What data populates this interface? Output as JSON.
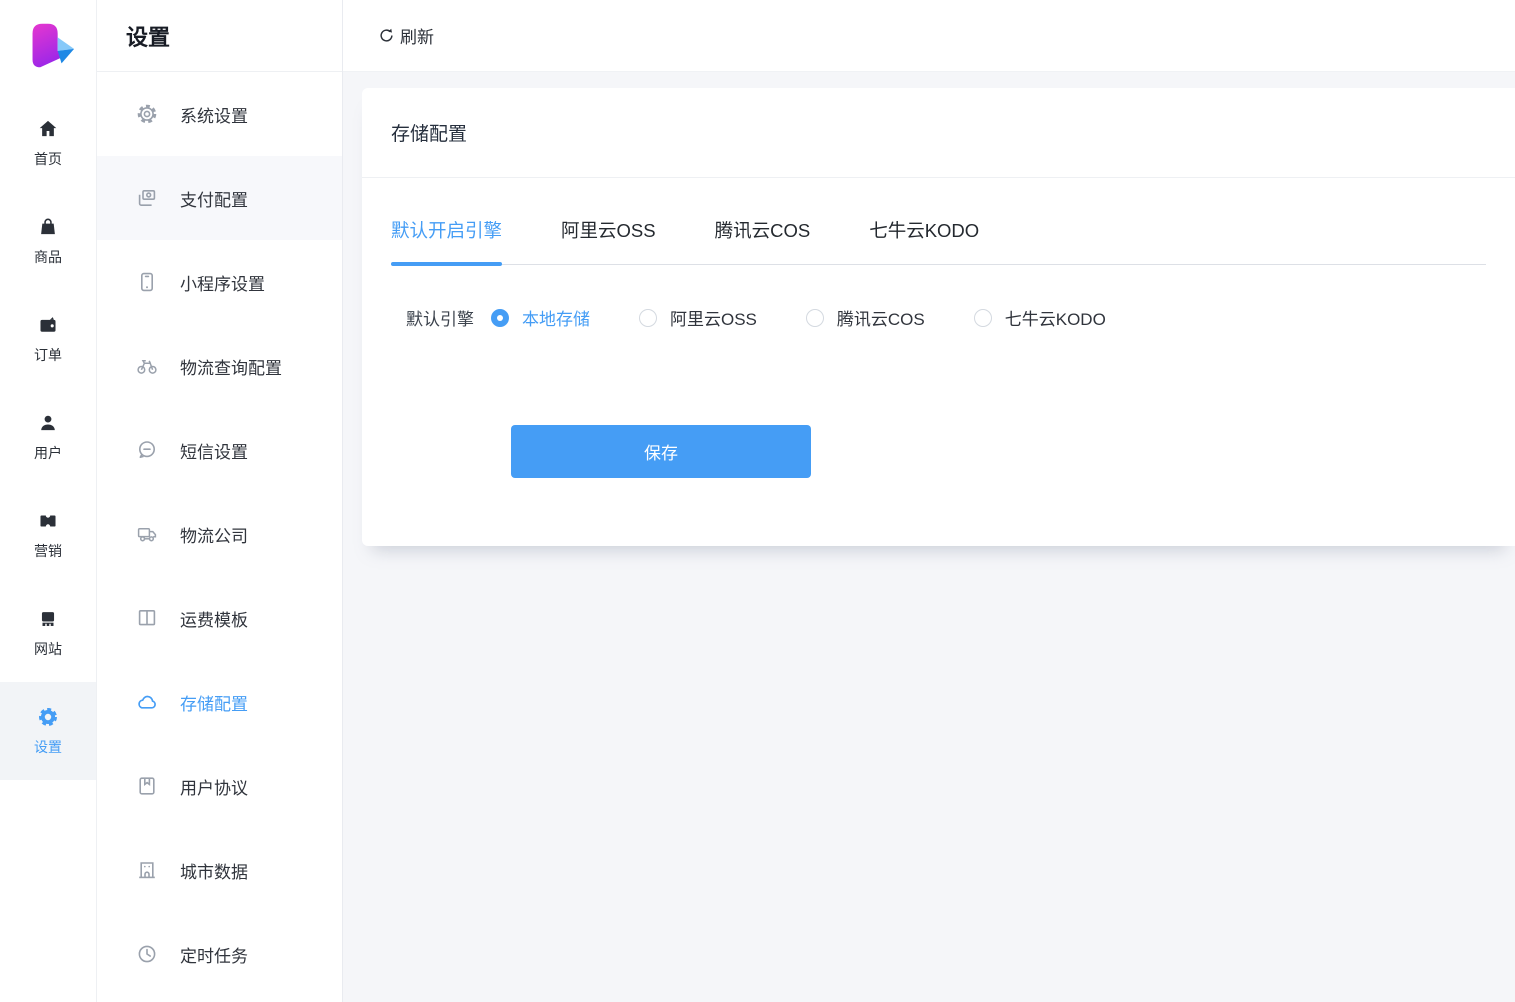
{
  "colors": {
    "accent": "#459df5",
    "content_bg": "#f5f6f9",
    "sidebar_bg": "#ffffff"
  },
  "iconbar": {
    "items": [
      {
        "label": "首页",
        "icon": "home-icon",
        "active": false
      },
      {
        "label": "商品",
        "icon": "goods-bag-icon",
        "active": false
      },
      {
        "label": "订单",
        "icon": "order-wallet-icon",
        "active": false
      },
      {
        "label": "用户",
        "icon": "user-icon",
        "active": false
      },
      {
        "label": "营销",
        "icon": "marketing-ticket-icon",
        "active": false
      },
      {
        "label": "网站",
        "icon": "website-icon",
        "active": false
      },
      {
        "label": "设置",
        "icon": "settings-gear-icon",
        "active": true
      }
    ]
  },
  "submenu": {
    "title": "设置",
    "items": [
      {
        "label": "系统设置",
        "icon": "system-gear-icon",
        "active": false,
        "highlighted": false
      },
      {
        "label": "支付配置",
        "icon": "payment-icon",
        "active": false,
        "highlighted": true
      },
      {
        "label": "小程序设置",
        "icon": "miniprogram-phone-icon",
        "active": false,
        "highlighted": false
      },
      {
        "label": "物流查询配置",
        "icon": "logistics-query-bicycle-icon",
        "active": false,
        "highlighted": false
      },
      {
        "label": "短信设置",
        "icon": "sms-chat-icon",
        "active": false,
        "highlighted": false
      },
      {
        "label": "物流公司",
        "icon": "logistics-truck-icon",
        "active": false,
        "highlighted": false
      },
      {
        "label": "运费模板",
        "icon": "freight-template-book-icon",
        "active": false,
        "highlighted": false
      },
      {
        "label": "存储配置",
        "icon": "storage-cloud-icon",
        "active": true,
        "highlighted": false
      },
      {
        "label": "用户协议",
        "icon": "agreement-book-icon",
        "active": false,
        "highlighted": false
      },
      {
        "label": "城市数据",
        "icon": "city-data-building-icon",
        "active": false,
        "highlighted": false
      },
      {
        "label": "定时任务",
        "icon": "scheduled-task-clock-icon",
        "active": false,
        "highlighted": false
      }
    ]
  },
  "topbar": {
    "refresh_label": "刷新"
  },
  "card": {
    "title": "存储配置",
    "tabs": [
      {
        "label": "默认开启引擎",
        "active": true
      },
      {
        "label": "阿里云OSS",
        "active": false
      },
      {
        "label": "腾讯云COS",
        "active": false
      },
      {
        "label": "七牛云KODO",
        "active": false
      }
    ],
    "form": {
      "engine_label": "默认引擎",
      "options": [
        {
          "label": "本地存储",
          "selected": true
        },
        {
          "label": "阿里云OSS",
          "selected": false
        },
        {
          "label": "腾讯云COS",
          "selected": false
        },
        {
          "label": "七牛云KODO",
          "selected": false
        }
      ]
    },
    "save_label": "保存"
  }
}
